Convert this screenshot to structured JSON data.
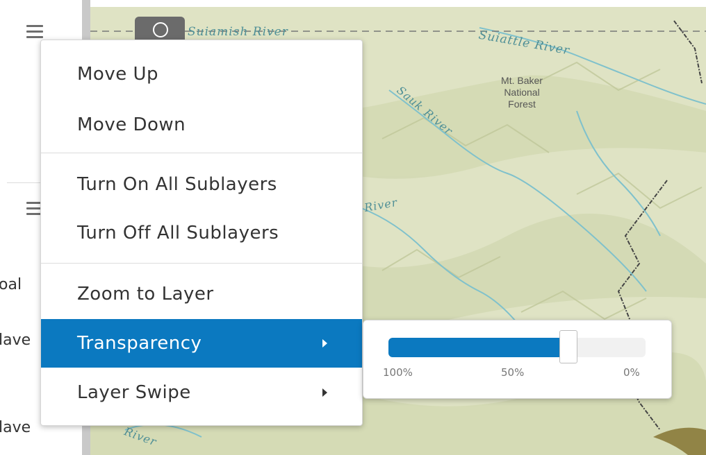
{
  "layer_list": {
    "partial_labels": [
      "oal",
      "lave",
      "lave"
    ]
  },
  "map": {
    "labels": {
      "river_top": "Suiamish River",
      "suiattle": "Suiattle River",
      "sauk": "Sauk River",
      "river_mid": "River",
      "river_bottom": "River"
    },
    "forest_label": [
      "Mt. Baker",
      "National",
      "Forest"
    ]
  },
  "context_menu": {
    "items": [
      {
        "label": "Move Up"
      },
      {
        "label": "Move Down"
      },
      {
        "label": "Turn On All Sublayers"
      },
      {
        "label": "Turn Off All Sublayers"
      },
      {
        "label": "Zoom to Layer"
      },
      {
        "label": "Transparency",
        "active": true,
        "submenu": true
      },
      {
        "label": "Layer Swipe",
        "submenu": true
      }
    ]
  },
  "transparency": {
    "value_fraction": 0.7,
    "ticks": [
      "100%",
      "50%",
      "0%"
    ]
  },
  "colors": {
    "accent": "#0b79c0",
    "map_bg": "#dfe3c4",
    "river": "#7fc1cc"
  }
}
